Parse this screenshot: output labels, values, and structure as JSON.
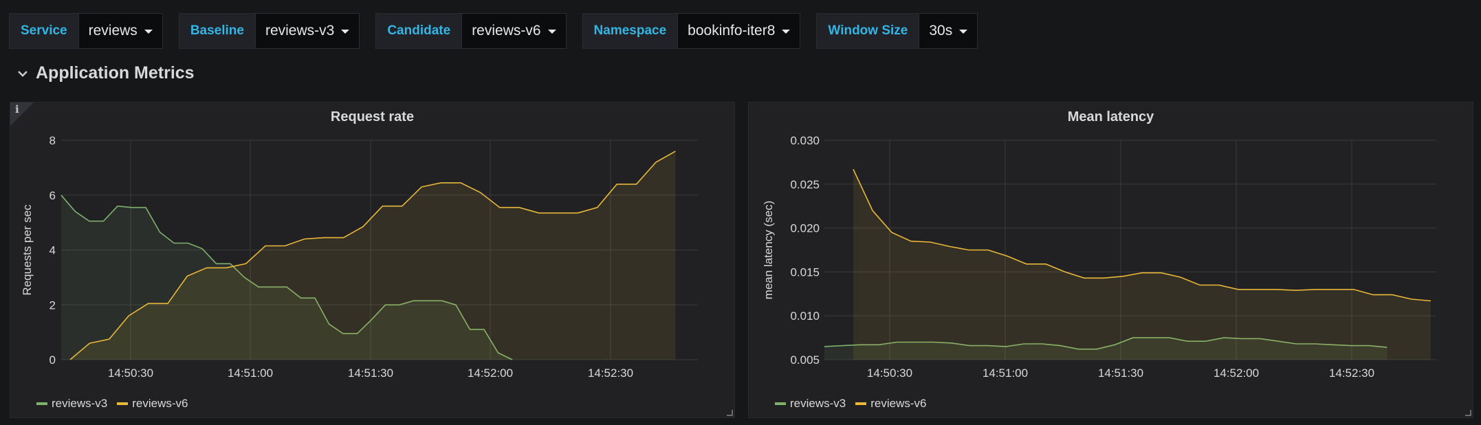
{
  "variables": [
    {
      "label": "Service",
      "value": "reviews"
    },
    {
      "label": "Baseline",
      "value": "reviews-v3"
    },
    {
      "label": "Candidate",
      "value": "reviews-v6"
    },
    {
      "label": "Namespace",
      "value": "bookinfo-iter8"
    },
    {
      "label": "Window Size",
      "value": "30s"
    }
  ],
  "row": {
    "title": "Application Metrics"
  },
  "colors": {
    "baseline": "#7eb26d",
    "candidate": "#eab839",
    "label": "#33b5e5"
  },
  "panels": [
    {
      "title": "Request rate",
      "legend": [
        "reviews-v3",
        "reviews-v6"
      ],
      "chart_data": {
        "type": "area",
        "title": "Request rate",
        "ylabel": "Requests per sec",
        "ylim": [
          0,
          8
        ],
        "yticks": [
          0,
          2,
          4,
          6,
          8
        ],
        "xticks": [
          "14:50:30",
          "14:51:00",
          "14:51:30",
          "14:52:00",
          "14:52:30"
        ],
        "x": [
          "14:50:18",
          "14:50:20",
          "14:50:23",
          "14:50:26",
          "14:50:29",
          "14:50:32",
          "14:50:35",
          "14:50:38",
          "14:50:41",
          "14:50:44",
          "14:50:47",
          "14:50:50",
          "14:50:53",
          "14:50:56",
          "14:50:59",
          "14:51:02",
          "14:51:05",
          "14:51:08",
          "14:51:11",
          "14:51:14",
          "14:51:17",
          "14:51:20",
          "14:51:23",
          "14:51:26",
          "14:51:29",
          "14:51:32",
          "14:51:35",
          "14:51:38",
          "14:51:41",
          "14:51:44",
          "14:51:47",
          "14:51:50",
          "14:51:53",
          "14:51:56",
          "14:51:59",
          "14:52:02",
          "14:52:05",
          "14:52:08",
          "14:52:11",
          "14:52:14",
          "14:52:17",
          "14:52:20",
          "14:52:23",
          "14:52:26",
          "14:52:29",
          "14:52:32",
          "14:52:35",
          "14:52:38",
          "14:52:41",
          "14:52:44",
          "14:52:47"
        ],
        "series": [
          {
            "name": "reviews-v3",
            "values": [
              6.0,
              5.4,
              5.05,
              5.05,
              5.6,
              5.55,
              5.55,
              4.65,
              4.25,
              4.25,
              4.05,
              3.5,
              3.5,
              3.0,
              2.65,
              2.65,
              2.65,
              2.25,
              2.25,
              1.3,
              0.95,
              0.95,
              1.45,
              2.0,
              2.0,
              2.15,
              2.15,
              2.15,
              2.0,
              1.1,
              1.1,
              0.25,
              0.0
            ]
          },
          {
            "name": "reviews-v6",
            "values": [
              0.0,
              0.6,
              0.75,
              1.6,
              2.05,
              2.05,
              3.05,
              3.35,
              3.35,
              3.5,
              4.15,
              4.15,
              4.4,
              4.45,
              4.45,
              4.85,
              5.6,
              5.6,
              6.3,
              6.45,
              6.45,
              6.1,
              5.55,
              5.55,
              5.35,
              5.35,
              5.35,
              5.55,
              6.4,
              6.4,
              7.2,
              7.6
            ]
          }
        ]
      }
    },
    {
      "title": "Mean latency",
      "legend": [
        "reviews-v3",
        "reviews-v6"
      ],
      "chart_data": {
        "type": "area",
        "title": "Mean latency",
        "ylabel": "mean latency (sec)",
        "ylim": [
          0.005,
          0.03
        ],
        "yticks": [
          "0.005",
          "0.010",
          "0.015",
          "0.020",
          "0.025",
          "0.030"
        ],
        "xticks": [
          "14:50:30",
          "14:51:00",
          "14:51:30",
          "14:52:00",
          "14:52:30"
        ],
        "series": [
          {
            "name": "reviews-v3",
            "values": [
              0.0065,
              0.0066,
              0.0067,
              0.0067,
              0.007,
              0.007,
              0.007,
              0.0069,
              0.0066,
              0.0066,
              0.0065,
              0.0068,
              0.0068,
              0.0066,
              0.0062,
              0.0062,
              0.0067,
              0.0075,
              0.0075,
              0.0075,
              0.0071,
              0.0071,
              0.0075,
              0.0074,
              0.0074,
              0.0071,
              0.0068,
              0.0068,
              0.0067,
              0.0066,
              0.0066,
              0.0064
            ]
          },
          {
            "name": "reviews-v6",
            "values": [
              0.0267,
              0.022,
              0.0195,
              0.0185,
              0.0184,
              0.0179,
              0.0175,
              0.0175,
              0.0168,
              0.0159,
              0.0159,
              0.015,
              0.0143,
              0.0143,
              0.0145,
              0.0149,
              0.0149,
              0.0144,
              0.0135,
              0.0135,
              0.013,
              0.013,
              0.013,
              0.0129,
              0.013,
              0.013,
              0.013,
              0.0124,
              0.0124,
              0.0119,
              0.0117
            ]
          }
        ]
      }
    }
  ]
}
